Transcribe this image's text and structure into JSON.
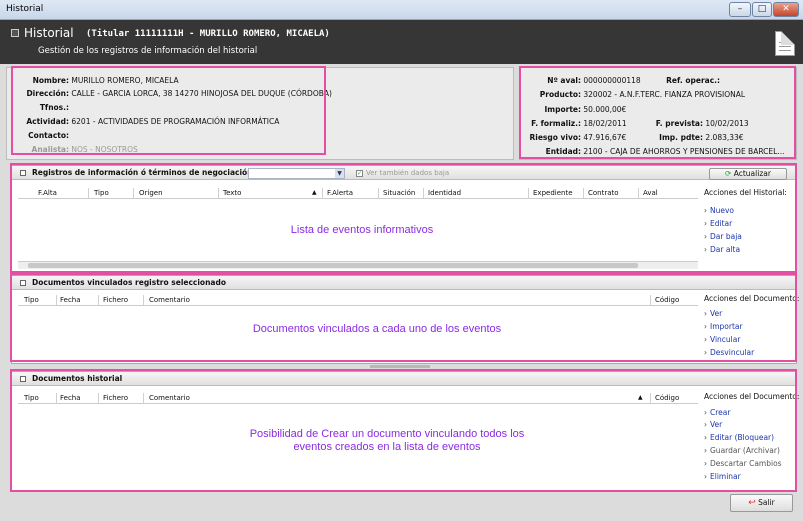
{
  "window": {
    "title": "Historial",
    "min": "–",
    "max": "□",
    "close": "✕"
  },
  "header": {
    "title": "Historial",
    "subtitle": "(Titular 11111111H - MURILLO ROMERO, MICAELA)",
    "description": "Gestión de los registros de información del historial"
  },
  "client": {
    "nombre_label": "Nombre:",
    "nombre": "MURILLO ROMERO, MICAELA",
    "direccion_label": "Dirección:",
    "direccion": "CALLE - GARCIA LORCA, 38  14270 HINOJOSA DEL DUQUE (CÓRDOBA)",
    "tfnos_label": "Tfnos.:",
    "tfnos": "",
    "actividad_label": "Actividad:",
    "actividad": "6201 - ACTIVIDADES DE PROGRAMACIÓN INFORMÁTICA",
    "contacto_label": "Contacto:",
    "contacto": "",
    "analista_label": "Analista:",
    "analista": "NOS - NOSOTROS"
  },
  "loan": {
    "aval_label": "Nº aval:",
    "aval": "000000000118",
    "refop_label": "Ref. operac.:",
    "refop": "",
    "producto_label": "Producto:",
    "producto": "320002 - A.N.F.TERC. FIANZA PROVISIONAL",
    "importe_label": "Importe:",
    "importe": "50.000,00€",
    "fformaliz_label": "F. formaliz.:",
    "fformaliz": "18/02/2011",
    "fprevista_label": "F. prevista:",
    "fprevista": "10/02/2013",
    "riesgo_label": "Riesgo vivo:",
    "riesgo": "47.916,67€",
    "imppdte_label": "Imp. pdte:",
    "imppdte": "2.083,33€",
    "entidad_label": "Entidad:",
    "entidad": "2100 - CAJA DE AHORROS Y PENSIONES DE BARCEL..."
  },
  "registros": {
    "title": "Registros de información ó términos de negociación",
    "show_bajas": "Ver también dados baja",
    "refresh": "Actualizar",
    "columns": [
      "F.Alta",
      "Tipo",
      "Origen",
      "Texto",
      "F.Alerta",
      "Situación",
      "Identidad",
      "Expediente",
      "Contrato",
      "Aval"
    ],
    "note": "Lista de eventos informativos",
    "actions_title": "Acciones del Historial:",
    "actions": [
      "Nuevo",
      "Editar",
      "Dar baja",
      "Dar alta"
    ]
  },
  "vinculados": {
    "title": "Documentos vinculados registro seleccionado",
    "columns": [
      "Tipo",
      "Fecha",
      "Fichero",
      "Comentario",
      "Código"
    ],
    "note": "Documentos vinculados a cada uno de los eventos",
    "actions_title": "Acciones del Documento:",
    "actions": [
      "Ver",
      "Importar",
      "Vincular",
      "Desvincular"
    ]
  },
  "historial": {
    "title": "Documentos historial",
    "columns": [
      "Tipo",
      "Fecha",
      "Fichero",
      "Comentario",
      "Código"
    ],
    "note": "Posibilidad de Crear un documento vinculando todos los eventos creados en la lista de eventos",
    "actions_title": "Acciones del Documento:",
    "actions": [
      "Crear",
      "Ver",
      "Editar (Bloquear)",
      "Guardar (Archivar)",
      "Descartar Cambios",
      "Eliminar"
    ]
  },
  "footer": {
    "exit": "Salir"
  },
  "colors": {
    "highlight": "#e24fa3",
    "note": "#8a2be2",
    "link": "#1c36a8"
  }
}
